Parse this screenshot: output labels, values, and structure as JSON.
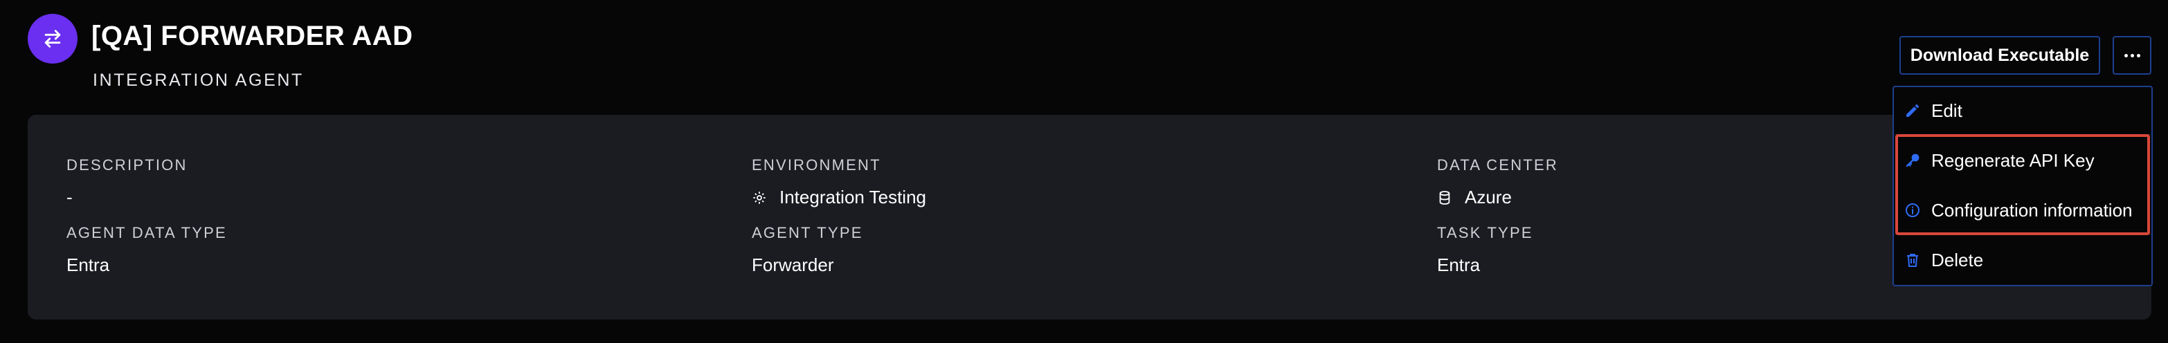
{
  "header": {
    "title": "[QA] FORWARDER AAD",
    "subtitle": "INTEGRATION AGENT",
    "avatar_icon": "swap-arrows-icon",
    "avatar_color": "#6a2ff0"
  },
  "actions": {
    "download_label": "Download Executable",
    "more_icon": "ellipsis-icon"
  },
  "details": {
    "description_label": "DESCRIPTION",
    "description_value": "-",
    "environment_label": "ENVIRONMENT",
    "environment_value": "Integration Testing",
    "environment_icon": "gear-icon",
    "data_center_label": "DATA CENTER",
    "data_center_value": "Azure",
    "data_center_icon": "database-icon",
    "agent_data_type_label": "AGENT DATA TYPE",
    "agent_data_type_value": "Entra",
    "agent_type_label": "AGENT TYPE",
    "agent_type_value": "Forwarder",
    "task_type_label": "TASK TYPE",
    "task_type_value": "Entra"
  },
  "menu": {
    "items": [
      {
        "label": "Edit",
        "icon": "pencil-icon"
      },
      {
        "label": "Regenerate API Key",
        "icon": "key-icon"
      },
      {
        "label": "Configuration information",
        "icon": "info-icon"
      },
      {
        "label": "Delete",
        "icon": "trash-icon"
      }
    ],
    "icon_color": "#2f6cf6",
    "highlight_color": "#d9473a"
  }
}
